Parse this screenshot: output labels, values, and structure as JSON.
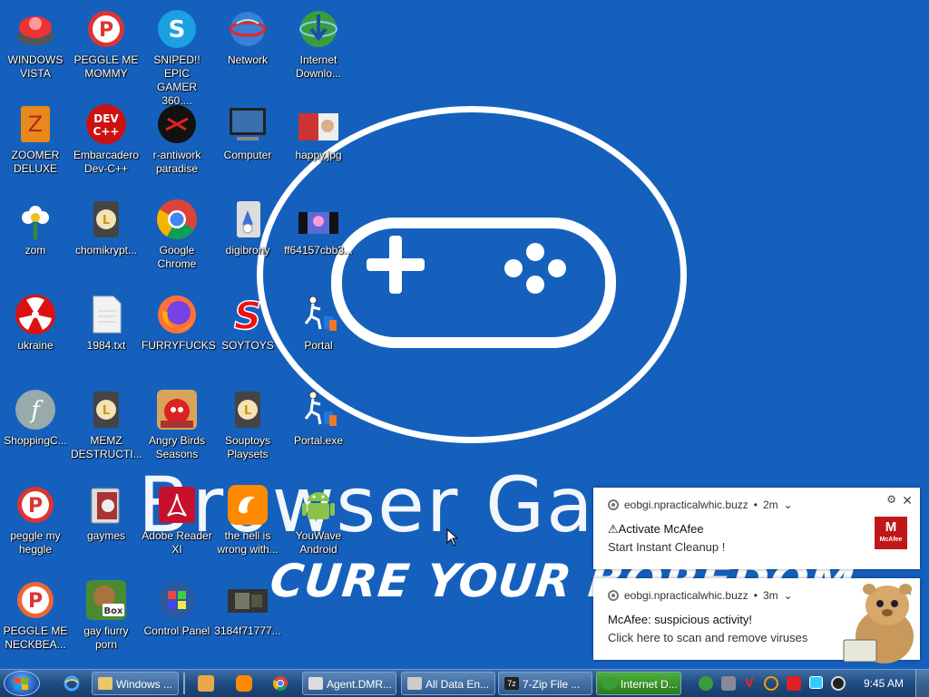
{
  "desktop": {
    "wallpaper": {
      "title": "Browser Ga",
      "tagline": "CURE YOUR BOREDOM"
    },
    "icons": [
      {
        "label": "WINDOWS\nVISTA"
      },
      {
        "label": "PEGGLE ME\nMOMMY"
      },
      {
        "label": "SNIPED!! EPIC\nGAMER 360...."
      },
      {
        "label": "Network"
      },
      {
        "label": "Internet\nDownlo..."
      },
      {
        "label": "ZOOMER\nDELUXE"
      },
      {
        "label": "Embarcadero\nDev-C++"
      },
      {
        "label": "r-antiwork\nparadise"
      },
      {
        "label": "Computer"
      },
      {
        "label": "happy.jpg"
      },
      {
        "label": "zom"
      },
      {
        "label": "chomikrypt..."
      },
      {
        "label": "Google\nChrome"
      },
      {
        "label": "digibrony"
      },
      {
        "label": "ff64157cbb3..."
      },
      {
        "label": "ukraine"
      },
      {
        "label": "1984.txt"
      },
      {
        "label": "FURRYFUCKS"
      },
      {
        "label": "SOYTOYS"
      },
      {
        "label": "Portal"
      },
      {
        "label": "ShoppingC..."
      },
      {
        "label": "MEMZ\nDESTRUCTI..."
      },
      {
        "label": "Angry Birds\nSeasons"
      },
      {
        "label": "Souptoys\nPlaysets"
      },
      {
        "label": "Portal.exe"
      },
      {
        "label": "peggle my\nheggle"
      },
      {
        "label": "gaymes"
      },
      {
        "label": "Adobe Reader\nXI"
      },
      {
        "label": "the hell is\nwrong with..."
      },
      {
        "label": "YouWave\nAndroid"
      },
      {
        "label": "PEGGLE ME\nNECKBEA..."
      },
      {
        "label": "gay fiurry\nporn"
      },
      {
        "label": "Control Panel"
      },
      {
        "label": "3184f71777..."
      }
    ]
  },
  "notifications": [
    {
      "source": "eobgi.npracticalwhic.buzz",
      "age": "2m",
      "title": "⚠Activate McAfee",
      "body": "Start Instant Cleanup !",
      "logo_text": "McAfee"
    },
    {
      "source": "eobgi.npracticalwhic.buzz",
      "age": "3m",
      "title": "McAfee: suspicious activity!",
      "body": "Click here to scan and remove viruses"
    }
  ],
  "taskbar": {
    "buttons": [
      {
        "label": "Windows ..."
      },
      {
        "label": "Agent.DMR..."
      },
      {
        "label": "All Data En..."
      },
      {
        "label": "7-Zip File ..."
      },
      {
        "label": "Internet D..."
      }
    ],
    "clock": "9:45 AM"
  },
  "colors": {
    "desktop": "#1560bd",
    "mcafee_red": "#c01818",
    "taskbar": "#1f4c80"
  }
}
